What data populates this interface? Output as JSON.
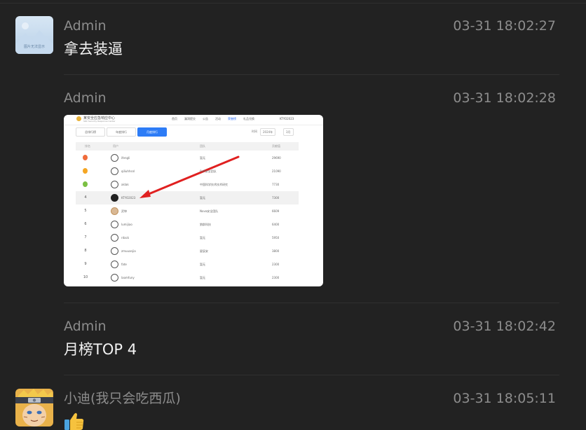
{
  "messages": [
    {
      "sender": "Admin",
      "time": "03-31 18:02:27",
      "text": "拿去装逼",
      "avatar_caption": "图片无法显示"
    },
    {
      "sender": "Admin",
      "time": "03-31 18:02:28",
      "image": {
        "site_title": "某安全应急响应中心",
        "site_subtitle": "SRC Security Response Center",
        "nav": [
          "首页",
          "漏洞提交",
          "公告",
          "活动",
          "荣誉榜",
          "礼品兑换"
        ],
        "nav_active": "荣誉榜",
        "user": "KTYO2023",
        "tabs": [
          "总排行榜",
          "年度排行",
          "月度排行"
        ],
        "tab_active": "月度排行",
        "filter_label": "时间",
        "filter_year": "2024年",
        "filter_month": "3月",
        "columns": [
          "排名",
          "用户",
          "团队",
          "贡献值"
        ],
        "rows": [
          {
            "rank": "1",
            "user": "ifengli",
            "team": "暂无",
            "score": "29690"
          },
          {
            "rank": "2",
            "user": "qiliuhhsnl",
            "team": "0xff安全团队",
            "score": "21090"
          },
          {
            "rank": "3",
            "user": "aklak",
            "team": "中国科学技术技术研究",
            "score": "7730"
          },
          {
            "rank": "4",
            "user": "KTYO2023",
            "team": "暂无",
            "score": "7300"
          },
          {
            "rank": "5",
            "user": "武坤",
            "team": "Nova安全团队",
            "score": "6609"
          },
          {
            "rank": "6",
            "user": "lumijiao",
            "team": "狼群科技",
            "score": "6400"
          },
          {
            "rank": "7",
            "user": "rdack",
            "team": "暂无",
            "score": "5950"
          },
          {
            "rank": "8",
            "user": "zmuuanjia",
            "team": "星辰安",
            "score": "3800"
          },
          {
            "rank": "9",
            "user": "fate",
            "team": "暂无",
            "score": "2300"
          },
          {
            "rank": "10",
            "user": "laomfuny",
            "team": "暂无",
            "score": "2300"
          }
        ],
        "highlight_rank": "4",
        "medal_colors": [
          "#f06c3c",
          "#f5a623",
          "#7bc043"
        ],
        "arrow_color": "#e02020"
      }
    },
    {
      "sender": "Admin",
      "time": "03-31 18:02:42",
      "text": "月榜TOP 4"
    },
    {
      "sender": "小迪(我只会吃西瓜)",
      "time": "03-31 18:05:11",
      "emoji": "thumbs-up"
    }
  ]
}
